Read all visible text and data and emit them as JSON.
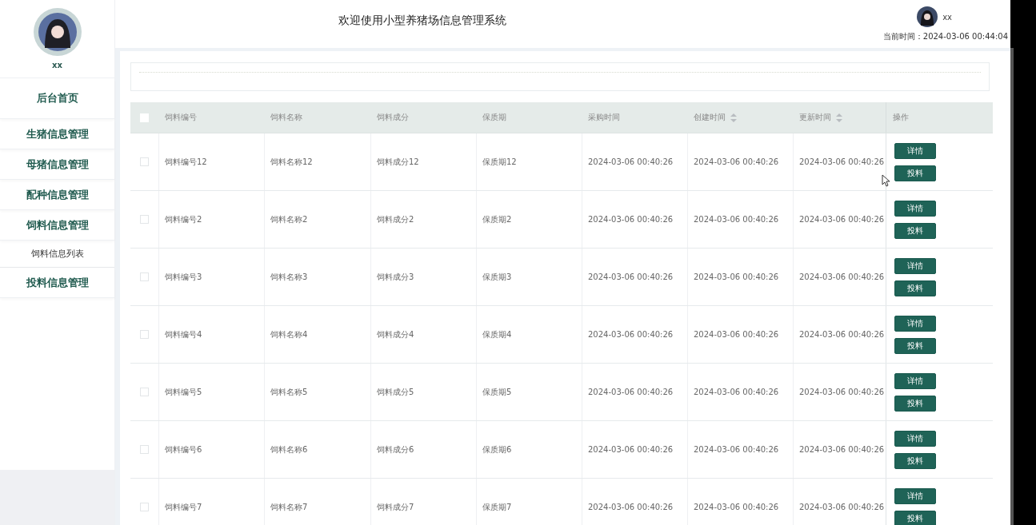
{
  "sidebar": {
    "user_name": "xx",
    "menu": [
      {
        "label": "后台首页"
      },
      {
        "label": "生猪信息管理"
      },
      {
        "label": "母猪信息管理"
      },
      {
        "label": "配种信息管理"
      },
      {
        "label": "饲料信息管理",
        "children": [
          {
            "label": "饲料信息列表"
          }
        ]
      },
      {
        "label": "投料信息管理"
      }
    ]
  },
  "header": {
    "title": "欢迎使用小型养猪场信息管理系统",
    "user_name": "xx",
    "time_label": "当前时间：",
    "time": "2024-03-06 00:44:04"
  },
  "table": {
    "select_all_checked": false,
    "columns": [
      {
        "label": "饲料编号",
        "sortable": false
      },
      {
        "label": "饲料名称",
        "sortable": false
      },
      {
        "label": "饲料成分",
        "sortable": false
      },
      {
        "label": "保质期",
        "sortable": false
      },
      {
        "label": "采购时间",
        "sortable": false
      },
      {
        "label": "创建时间",
        "sortable": true
      },
      {
        "label": "更新时间",
        "sortable": true
      },
      {
        "label": "操作",
        "sortable": false
      }
    ],
    "rows": [
      {
        "checked": false,
        "cells": [
          "饲料编号12",
          "饲料名称12",
          "饲料成分12",
          "保质期12",
          "2024-03-06 00:40:26",
          "2024-03-06 00:40:26",
          "2024-03-06 00:40:26"
        ],
        "actions": [
          "详情",
          "投料"
        ]
      },
      {
        "checked": false,
        "cells": [
          "饲料编号2",
          "饲料名称2",
          "饲料成分2",
          "保质期2",
          "2024-03-06 00:40:26",
          "2024-03-06 00:40:26",
          "2024-03-06 00:40:26"
        ],
        "actions": [
          "详情",
          "投料"
        ]
      },
      {
        "checked": false,
        "cells": [
          "饲料编号3",
          "饲料名称3",
          "饲料成分3",
          "保质期3",
          "2024-03-06 00:40:26",
          "2024-03-06 00:40:26",
          "2024-03-06 00:40:26"
        ],
        "actions": [
          "详情",
          "投料"
        ]
      },
      {
        "checked": false,
        "cells": [
          "饲料编号4",
          "饲料名称4",
          "饲料成分4",
          "保质期4",
          "2024-03-06 00:40:26",
          "2024-03-06 00:40:26",
          "2024-03-06 00:40:26"
        ],
        "actions": [
          "详情",
          "投料"
        ]
      },
      {
        "checked": false,
        "cells": [
          "饲料编号5",
          "饲料名称5",
          "饲料成分5",
          "保质期5",
          "2024-03-06 00:40:26",
          "2024-03-06 00:40:26",
          "2024-03-06 00:40:26"
        ],
        "actions": [
          "详情",
          "投料"
        ]
      },
      {
        "checked": false,
        "cells": [
          "饲料编号6",
          "饲料名称6",
          "饲料成分6",
          "保质期6",
          "2024-03-06 00:40:26",
          "2024-03-06 00:40:26",
          "2024-03-06 00:40:26"
        ],
        "actions": [
          "详情",
          "投料"
        ]
      },
      {
        "checked": false,
        "cells": [
          "饲料编号7",
          "饲料名称7",
          "饲料成分7",
          "保质期7",
          "2024-03-06 00:40:26",
          "2024-03-06 00:40:26",
          "2024-03-06 00:40:26"
        ],
        "actions": [
          "详情",
          "投料"
        ]
      }
    ]
  }
}
